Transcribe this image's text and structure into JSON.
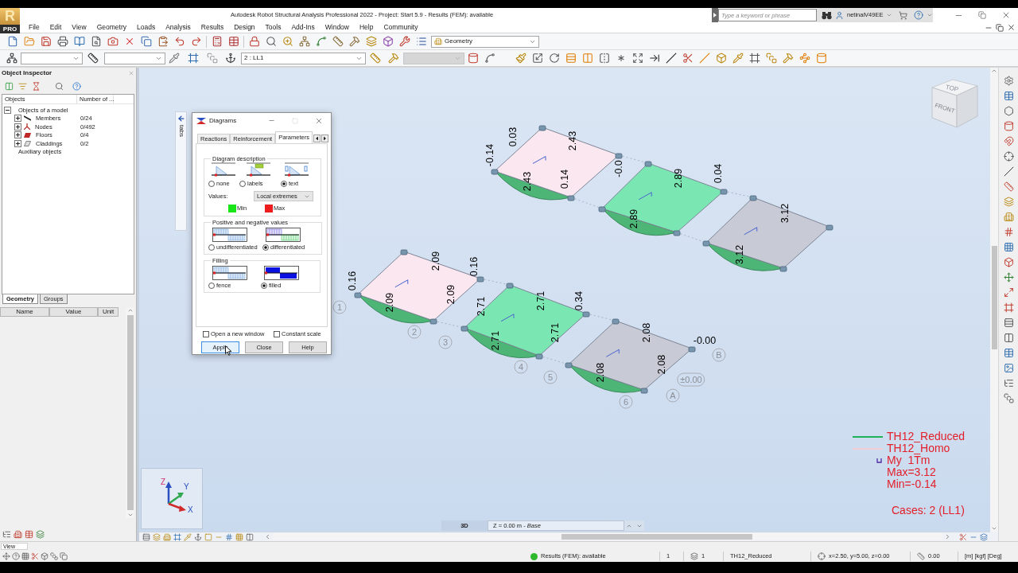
{
  "app_logo": {
    "letter": "R",
    "badge": "PRO"
  },
  "title_bar": {
    "title": "Autodesk Robot Structural Analysis Professional 2022 - Project: Start 5.9 - Results (FEM): available",
    "search": {
      "placeholder": "Type a keyword or phrase"
    },
    "user": "netinaiV49EE"
  },
  "menu": [
    "File",
    "Edit",
    "View",
    "Geometry",
    "Loads",
    "Analysis",
    "Results",
    "Design",
    "Tools",
    "Add-Ins",
    "Window",
    "Help",
    "Community"
  ],
  "toolbar": {
    "layout_selector": {
      "value": "Geometry"
    },
    "selectors": [
      {
        "disabled": false
      },
      {
        "disabled": false
      },
      {
        "value": "2 : LL1",
        "disabled": false
      },
      {
        "disabled": true
      }
    ]
  },
  "object_inspector": {
    "title": "Object Inspector",
    "columns": [
      "Objects",
      "Number of ..."
    ],
    "tree": [
      {
        "label": "Objects of a model",
        "expanded": true,
        "children": [
          {
            "label": "Members",
            "kind": "member",
            "count": "0/24",
            "expanded": false
          },
          {
            "label": "Nodes",
            "kind": "node",
            "count": "0/492",
            "expanded": false
          },
          {
            "label": "Floors",
            "kind": "floor",
            "count": "0/4",
            "expanded": false
          },
          {
            "label": "Claddings",
            "kind": "cladding",
            "count": "0/2",
            "expanded": false
          }
        ]
      },
      {
        "label": "Auxiliary objects"
      }
    ],
    "tabs": [
      {
        "label": "Geometry",
        "selected": true
      },
      {
        "label": "Groups",
        "selected": false
      }
    ],
    "properties": {
      "columns": [
        "Name",
        "Value",
        "Unit"
      ]
    }
  },
  "canvas": {
    "side_tab": "tabs",
    "view_cube": {
      "top": "TOP",
      "front": "FRONT"
    },
    "slabs": [
      {
        "color": "#fae7ef",
        "labels": [
          "0.03",
          "-0.14",
          "2.43",
          "2.43",
          "0.14",
          "-0.0"
        ]
      },
      {
        "color": "#7ae6b2",
        "labels": [
          "2.89",
          "0.04",
          "2.89"
        ]
      },
      {
        "color": "#c8cbd6",
        "labels": [
          "3.12",
          "3.12"
        ]
      },
      {
        "color": "#fae7ef",
        "labels": [
          "0.16",
          "2.09",
          "0.16",
          "2.09",
          "2.09"
        ]
      },
      {
        "color": "#7ae6b2",
        "labels": [
          "2.71",
          "0.34",
          "2.71",
          "2.71",
          "2.71"
        ]
      },
      {
        "color": "#c8cbd6",
        "labels": [
          "2.08",
          "-0.00",
          "2.08",
          "2.08"
        ]
      }
    ],
    "grid_marks": [
      "1",
      "2",
      "3",
      "4",
      "5",
      "6",
      "A",
      "B",
      "±0.00"
    ],
    "axes": [
      "Z",
      "Y",
      "X"
    ],
    "legend": {
      "series": [
        {
          "label": "TH12_Reduced",
          "color": "#20b05a"
        },
        {
          "label": "TH12_Homo",
          "color": "#f4cdd4"
        }
      ],
      "quantity": "My  1Tm",
      "max": "Max=3.12",
      "min": "Min=-0.14",
      "cases": "Cases: 2 (LL1)"
    },
    "view_mode": "3D",
    "storey": "Z = 0.00 m - *Base*"
  },
  "dialog": {
    "title": "Diagrams",
    "tabs": [
      {
        "label": "Reactions",
        "selected": false
      },
      {
        "label": "Reinforcement",
        "selected": false
      },
      {
        "label": "Parameters",
        "selected": true
      }
    ],
    "groups": [
      {
        "title": "Diagram description",
        "options": [
          {
            "label": "none",
            "selected": false
          },
          {
            "label": "labels",
            "selected": false
          },
          {
            "label": "text",
            "selected": true
          }
        ],
        "values_label": "Values:",
        "values": "Local extremes",
        "swatches": [
          {
            "label": "Min",
            "color": "#19e619"
          },
          {
            "label": "Max",
            "color": "#ee1c1c"
          }
        ]
      },
      {
        "title": "Positive and negative values",
        "options": [
          {
            "label": "undifferentiated",
            "selected": false
          },
          {
            "label": "differentiated",
            "selected": true
          }
        ]
      },
      {
        "title": "Filling",
        "options": [
          {
            "label": "fence",
            "selected": false
          },
          {
            "label": "filled",
            "selected": true
          }
        ]
      }
    ],
    "checkboxes": [
      {
        "label": "Open a new window",
        "checked": false
      },
      {
        "label": "Constant scale",
        "checked": false
      }
    ],
    "buttons": [
      {
        "label": "Apply",
        "focused": true
      },
      {
        "label": "Close",
        "focused": false
      },
      {
        "label": "Help",
        "focused": false
      }
    ]
  },
  "status_bar": {
    "mode": "View",
    "results": "Results (FEM): available",
    "fields": [
      "1",
      "1",
      "TH12_Reduced",
      "x=2.50, y=5.00, z=0.00",
      "0.00"
    ],
    "units": "[m] [kgf] [Deg]"
  }
}
